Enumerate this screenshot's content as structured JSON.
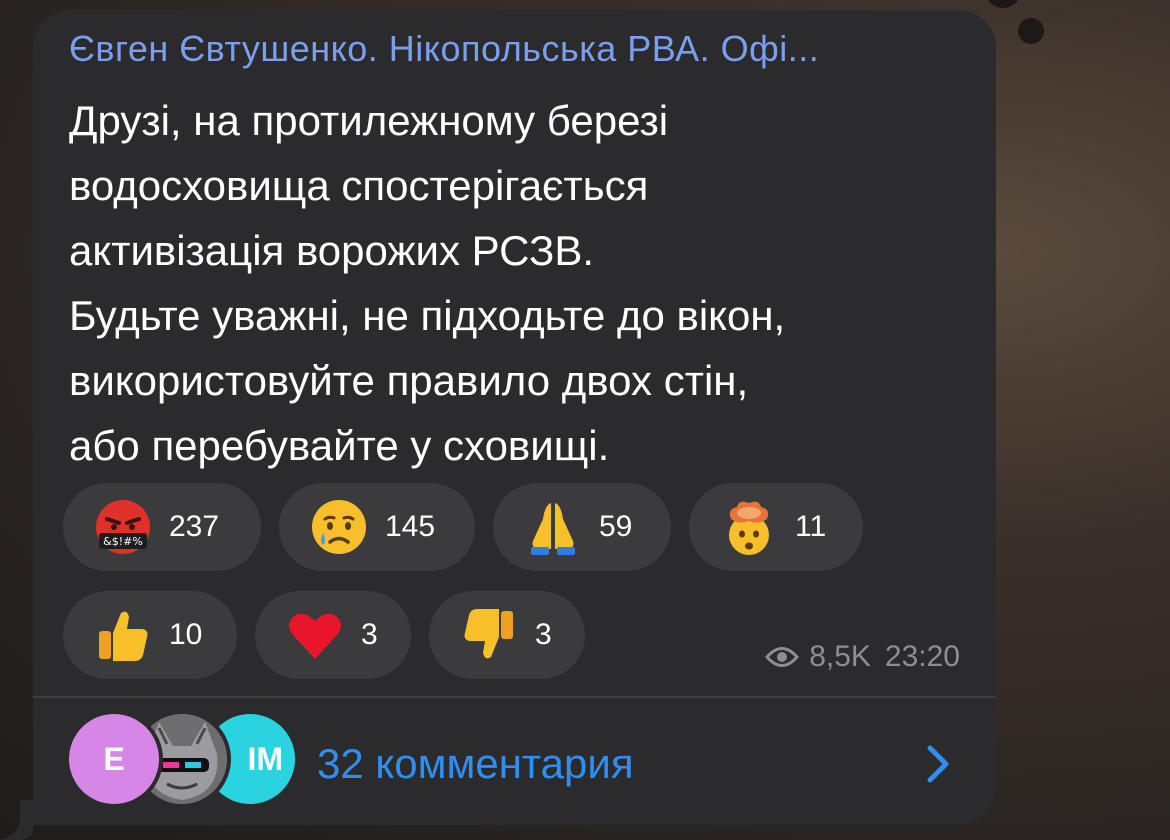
{
  "post": {
    "author": "Євген Євтушенко. Нікопольська РВА. Офі...",
    "lines": [
      "Друзі, на протилежному березі",
      "водосховища спостерігається",
      "активізація ворожих РСЗВ.",
      "Будьте уважні, не підходьте до вікон,",
      "використовуйте правило двох стін,",
      "або перебувайте у сховищі."
    ],
    "reactions": [
      {
        "icon": "cursing-face-icon",
        "count": "237"
      },
      {
        "icon": "crying-face-icon",
        "count": "145"
      },
      {
        "icon": "folded-hands-icon",
        "count": "59"
      },
      {
        "icon": "exploding-head-icon",
        "count": "11"
      },
      {
        "icon": "thumbs-up-icon",
        "count": "10"
      },
      {
        "icon": "red-heart-icon",
        "count": "3"
      },
      {
        "icon": "thumbs-down-icon",
        "count": "3"
      }
    ],
    "cursing_symbols": "&$!#%",
    "views": "8,5K",
    "time": "23:20"
  },
  "comments": {
    "avatars": [
      "E",
      "",
      "IM"
    ],
    "label": "32 комментария"
  },
  "colors": {
    "bubble": "#2b2b2d",
    "author": "#7a9ef0",
    "link": "#2f8ff0",
    "reaction_bg": "#3b3b3d"
  }
}
